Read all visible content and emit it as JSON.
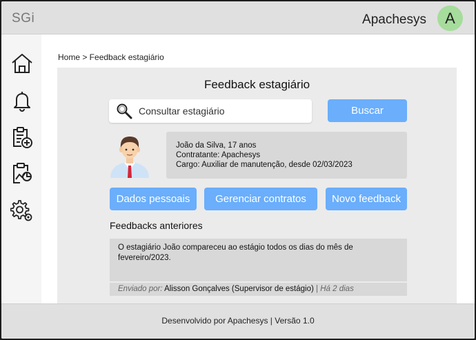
{
  "app": {
    "logo": "SGi"
  },
  "header": {
    "company": "Apachesys",
    "avatar_initial": "A"
  },
  "sidebar": {
    "items": [
      {
        "name": "home-icon"
      },
      {
        "name": "bell-icon"
      },
      {
        "name": "clipboard-add-icon"
      },
      {
        "name": "report-chart-icon"
      },
      {
        "name": "settings-gears-icon"
      }
    ]
  },
  "breadcrumb": "Home > Feedback estagiário",
  "page": {
    "title": "Feedback estagiário",
    "search": {
      "placeholder": "Consultar estagiário",
      "value": "",
      "button": "Buscar"
    },
    "intern": {
      "name_age": "João da Silva, 17 anos",
      "contractor": "Contratante: Apachesys",
      "role": "Cargo: Auxiliar de manutenção, desde 02/03/2023"
    },
    "actions": {
      "dados": "Dados pessoais",
      "contratos": "Gerenciar contratos",
      "novo": "Novo feedback"
    },
    "previous_title": "Feedbacks anteriores",
    "feedbacks": [
      {
        "text": "O estagiário João compareceu ao estágio todos os dias do mês de fevereiro/2023.",
        "sent_label": "Enviado por:",
        "author": "Alisson Gonçalves (Supervisor de estágio)",
        "separator": "|",
        "time": "Há 2 dias"
      }
    ]
  },
  "footer": "Desenvolvido por Apachesys | Versão 1.0",
  "colors": {
    "accent": "#6aaefc",
    "avatar": "#a6dc9c",
    "panel": "#ebebeb",
    "card": "#d8d8d8"
  }
}
